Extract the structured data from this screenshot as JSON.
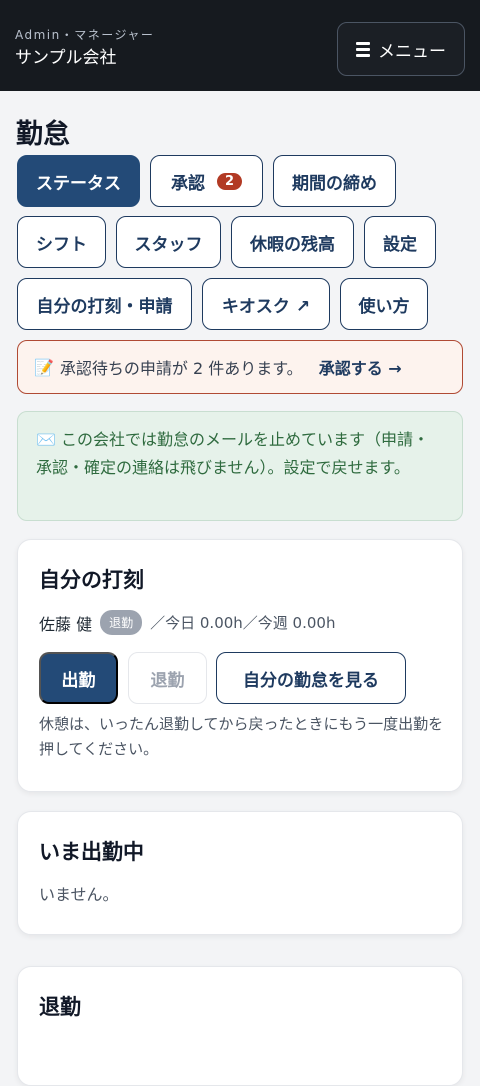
{
  "header": {
    "role": "Admin・マネージャー",
    "company": "サンプル会社",
    "menu_label": "メニュー",
    "menu_icon": "hamburger-icon"
  },
  "page": {
    "title": "勤怠"
  },
  "tabs": [
    {
      "label": "ステータス",
      "active": true
    },
    {
      "label": "承認",
      "badge": "2"
    },
    {
      "label": "期間の締め"
    },
    {
      "label": "シフト"
    },
    {
      "label": "スタッフ"
    },
    {
      "label": "休暇の残高"
    },
    {
      "label": "設定"
    },
    {
      "label": "自分の打刻・申請"
    },
    {
      "label": "キオスク ↗"
    },
    {
      "label": "使い方"
    }
  ],
  "alerts": {
    "pending": {
      "icon": "📝",
      "text": "承認待ちの申請が 2 件あります。",
      "link": "承認する →"
    },
    "mail": {
      "icon": "✉️",
      "text": "この会社では勤怠のメールを止めています（申請・承認・確定の連絡は飛びません）。設定で戻せます。"
    }
  },
  "self_card": {
    "title": "自分の打刻",
    "user_name": "佐藤 健",
    "status": "退勤",
    "hours": "／今日 0.00h／今週 0.00h",
    "clock_in": "出勤",
    "clock_out": "退勤",
    "view_mine": "自分の勤怠を見る",
    "hint": "休憩は、いったん退勤してから戻ったときにもう一度出勤を押してください。"
  },
  "now_card": {
    "title": "いま出勤中",
    "empty": "いません。"
  },
  "out_card": {
    "title": "退勤"
  },
  "colors": {
    "primary": "#234a77",
    "badge": "#b23a24",
    "topbar": "#161a1f"
  }
}
